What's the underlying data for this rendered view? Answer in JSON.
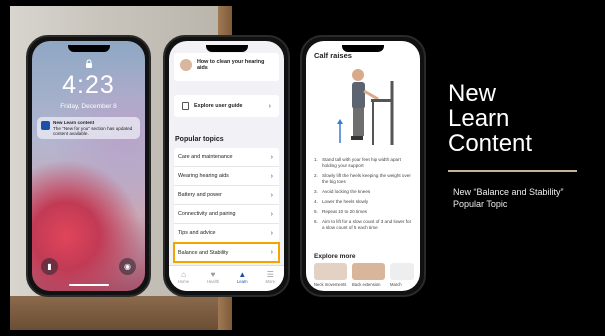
{
  "slide": {
    "title_lines": [
      "New",
      "Learn",
      "Content"
    ],
    "subtitle": "New “Balance and Stability” Popular Topic",
    "accent_color": "#c9b29b"
  },
  "lock_screen": {
    "time": "4:23",
    "date": "Friday, December 8",
    "notification": {
      "title": "New Learn content",
      "body": "The \"New for you\" section has updated content available."
    },
    "left_button_icon": "flashlight-icon",
    "right_button_icon": "camera-icon"
  },
  "learn_screen": {
    "tip_card": "How to clean your hearing aids",
    "guide_card": "Explore user guide",
    "popular_topics_title": "Popular topics",
    "topics": [
      "Care and maintenance",
      "Wearing hearing aids",
      "Battery and power",
      "Connectivity and pairing",
      "Tips and advice",
      "Balance and Stability"
    ],
    "highlighted_topic_index": 5,
    "highlight_color": "#f0a500",
    "tabs": [
      {
        "label": "Home",
        "icon": "home-icon"
      },
      {
        "label": "Health",
        "icon": "heart-icon"
      },
      {
        "label": "Learn",
        "icon": "graduation-cap-icon"
      },
      {
        "label": "More",
        "icon": "menu-icon"
      }
    ],
    "active_tab": "Learn",
    "accent_color": "#1b4fa8"
  },
  "calf_screen": {
    "title": "Calf raises",
    "steps": [
      "Stand tall with your feet hip width apart holding your support",
      "Slowly lift the heels keeping the weight over the big toes",
      "Avoid locking the knees",
      "Lower the heels slowly",
      "Repeat 10 to 20 times",
      "Aim to lift for a slow count of 3 and lower for a slow count of 5 each time"
    ],
    "explore_title": "Explore more",
    "explore_items": [
      "Neck movements",
      "Back extension",
      "March"
    ]
  }
}
